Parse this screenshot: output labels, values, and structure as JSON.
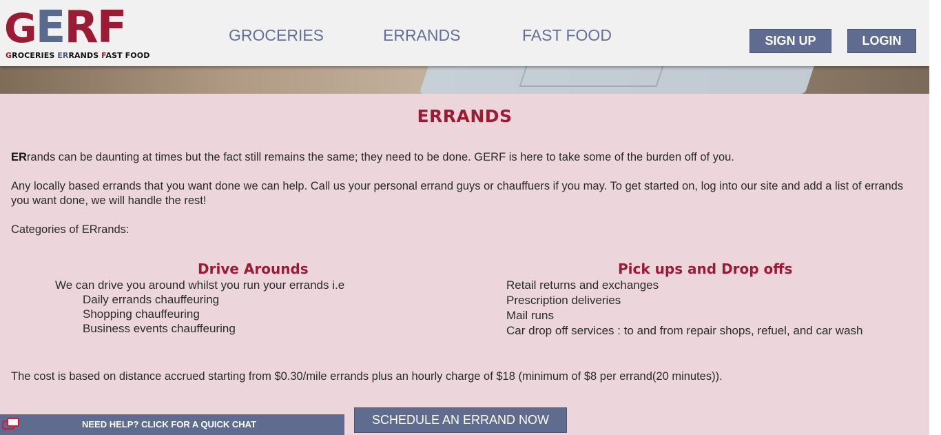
{
  "logo": {
    "letters": [
      "G",
      "E",
      "R",
      "F"
    ],
    "tagline": {
      "g": "G",
      "g_rest": "ROCERIES ",
      "er": "ER",
      "er_rest": "RANDS ",
      "f": "F",
      "f_rest": "AST FOOD"
    }
  },
  "nav": {
    "groceries": "GROCERIES",
    "errands": "ERRANDS",
    "fastfood": "FAST FOOD"
  },
  "auth": {
    "signup": "SIGN UP",
    "login": "LOGIN"
  },
  "main": {
    "title": "ERRANDS",
    "intro_bold": "ER",
    "intro_rest": "rands can be daunting at times but the fact still remains the same; they need to be done. GERF is here to take some of the burden off of you.",
    "para2": "Any locally based errands that you want done we can help. Call us your personal errand guys or chauffuers if you may. To get started on, log into our site and add a list of errands you want done, we will handle the rest!",
    "categories_label": "Categories of ERrands:",
    "drive": {
      "heading": "Drive Arounds",
      "intro": "We can drive you around whilst you run your errands i.e",
      "items": [
        "Daily errands chauffeuring",
        "Shopping chauffeuring",
        "Business events chauffeuring"
      ]
    },
    "pickup": {
      "heading": "Pick ups and Drop offs",
      "items": [
        "Retail returns and exchanges",
        "Prescription deliveries",
        "Mail runs",
        "Car drop off services : to and from repair shops, refuel, and car wash"
      ]
    },
    "cost": "The cost is based on distance accrued starting from $0.30/mile errands plus an hourly charge of $18 (minimum of $8 per errand(20 minutes)).",
    "schedule_button": "SCHEDULE AN ERRAND NOW"
  },
  "chat": {
    "label": "NEED HELP? CLICK FOR A QUICK CHAT",
    "icon": "chat-bubbles-icon"
  },
  "colors": {
    "accent": "#9b1b34",
    "nav": "#646f96",
    "button": "#5f6b8f",
    "background": "#ecd6dc"
  }
}
